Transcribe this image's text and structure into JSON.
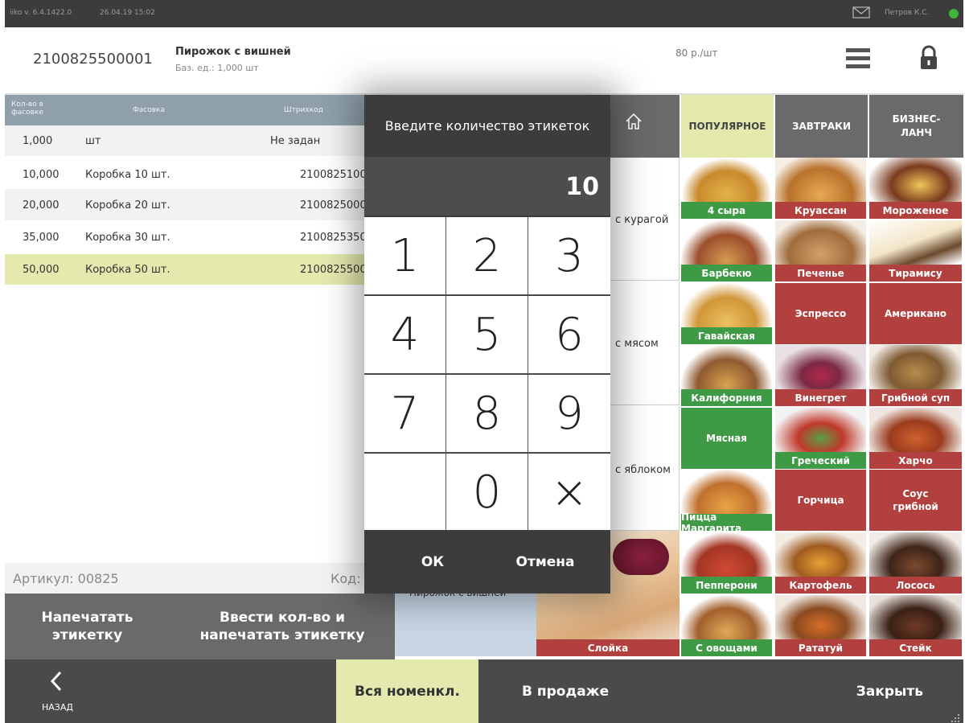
{
  "status": {
    "version": "iiko v. 6.4.1422.0",
    "datetime": "26.04.19  15:02",
    "user": "Петров К.С."
  },
  "header": {
    "barcode": "2100825500001",
    "product_name": "Пирожок с вишней",
    "base_unit": "Баз. ед.: 1,000 шт",
    "price": "80 р./шт"
  },
  "table": {
    "headers": {
      "qty": "Кол-во в фасовке",
      "packing": "Фасовка",
      "barcode": "Штрихкод"
    },
    "rows": [
      {
        "qty": "1,000",
        "packing": "шт",
        "barcode": "Не задан"
      },
      {
        "qty": "10,000",
        "packing": "Коробка 10 шт.",
        "barcode": "2100825100"
      },
      {
        "qty": "20,000",
        "packing": "Коробка 20 шт.",
        "barcode": "2100825000"
      },
      {
        "qty": "35,000",
        "packing": "Коробка 30 шт.",
        "barcode": "2100825350"
      },
      {
        "qty": "50,000",
        "packing": "Коробка 50 шт.",
        "barcode": "2100825500"
      }
    ]
  },
  "footer_info": {
    "article": "Артикул: 00825",
    "code": "Код:"
  },
  "actions": {
    "print_label": "Напечатать этикетку",
    "enter_qty_print": "Ввести кол-во и напечатать этикетку"
  },
  "categories": {
    "popular": "ПОПУЛЯРНОЕ",
    "breakfast": "ЗАВТРАКИ",
    "business_lunch": "БИЗНЕС-ЛАНЧ"
  },
  "middle_items": {
    "item1": "с курагой",
    "item2": "с мясом",
    "item3": "с яблоком",
    "item4": "Пирожок с вишней",
    "item5": "Слойка"
  },
  "menu_items": [
    "4 сыра",
    "Круассан",
    "Мороженое",
    "Барбекю",
    "Печенье",
    "Тирамису",
    "Гавайская",
    "Эспрессо",
    "Американо",
    "Калифорния",
    "Винегрет",
    "Грибной суп",
    "Мясная",
    "Греческий",
    "Харчо",
    "Пицца Маргарита",
    "Горчица",
    "Соус грибной",
    "Пепперони",
    "Картофель",
    "Лосось",
    "С овощами",
    "Рататуй",
    "Стейк"
  ],
  "bottom": {
    "back": "НАЗАД",
    "all_items": "Вся номенкл.",
    "on_sale": "В продаже",
    "close": "Закрыть"
  },
  "dialog": {
    "title": "Введите количество этикеток",
    "value": "10",
    "keys": [
      "1",
      "2",
      "3",
      "4",
      "5",
      "6",
      "7",
      "8",
      "9",
      "",
      "0",
      "×"
    ],
    "ok": "ОК",
    "cancel": "Отмена"
  },
  "colors": {
    "green": "#3f9a46",
    "red": "#b1403f",
    "selected": "#e4e9ae",
    "dark": "#3c3c3c"
  }
}
